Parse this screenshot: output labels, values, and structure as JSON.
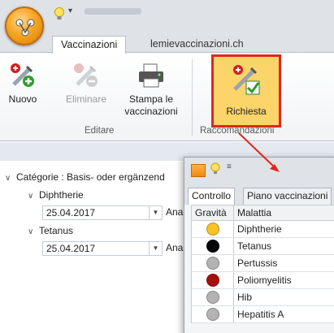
{
  "ribbon_tabs": [
    "Vaccinazioni",
    "lemievaccinazioni.ch"
  ],
  "ribbon": {
    "buttons": {
      "nuovo": "Nuovo",
      "eliminare": "Eliminare",
      "stampa_line1": "Stampa le",
      "stampa_line2": "vaccinazioni",
      "richiesta": "Richiesta"
    },
    "groups": {
      "editare": "Editare",
      "raccomandazioni": "Raccomandazioni"
    }
  },
  "tree": {
    "category": "Catégorie : Basis- oder ergänzend",
    "items": [
      {
        "label": "Diphtherie",
        "date": "25.04.2017",
        "trailing": "Ana"
      },
      {
        "label": "Tetanus",
        "date": "25.04.2017",
        "trailing": "Ana"
      }
    ]
  },
  "popup": {
    "tabs": [
      "Controllo",
      "Piano vaccinazioni"
    ],
    "columns": [
      "Gravità",
      "Malattia"
    ],
    "rows": [
      {
        "malattia": "Diphtherie",
        "color": "#f7c325"
      },
      {
        "malattia": "Tetanus",
        "color": "#050505"
      },
      {
        "malattia": "Pertussis",
        "color": "#b3b3b3"
      },
      {
        "malattia": "Poliomyelitis",
        "color": "#a5100e"
      },
      {
        "malattia": "Hib",
        "color": "#b3b3b3"
      },
      {
        "malattia": "Hepatitis A",
        "color": "#b3b3b3"
      }
    ]
  },
  "colors": {
    "highlight_border": "#e0261f",
    "highlight_fill": "#fbd46a",
    "arrow": "#e0261f"
  }
}
